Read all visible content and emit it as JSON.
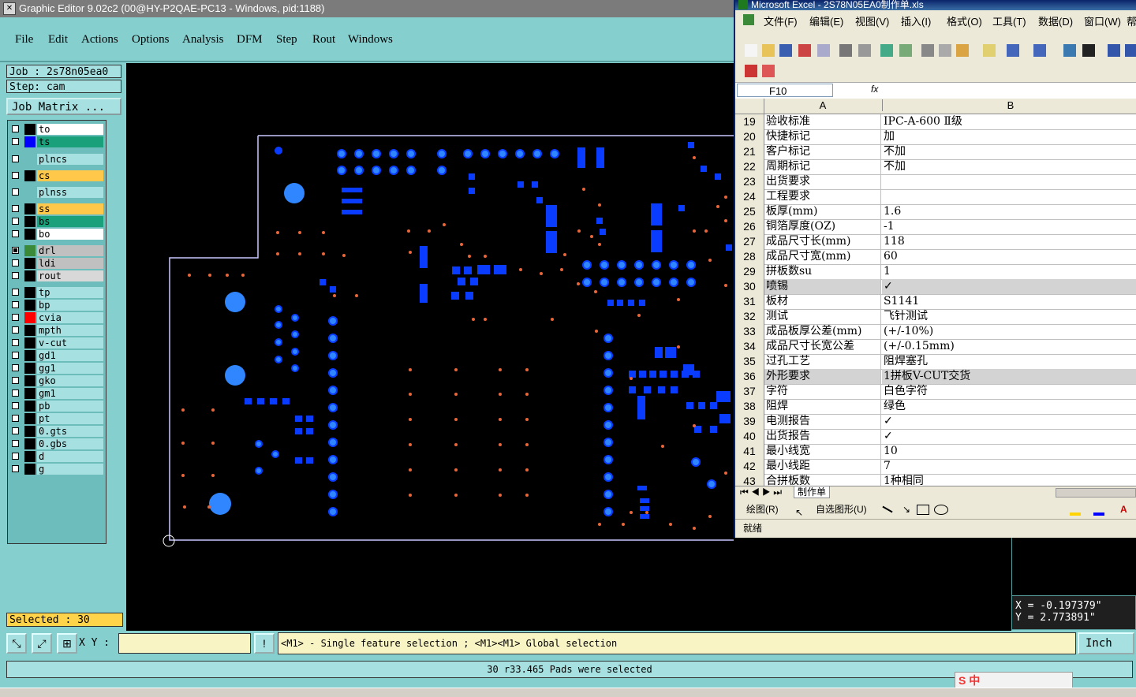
{
  "graphic_editor": {
    "title": "Graphic Editor 9.02c2 (00@HY-P2QAE-PC13 - Windows, pid:1188)",
    "menu": [
      "File",
      "Edit",
      "Actions",
      "Options",
      "Analysis",
      "DFM",
      "Step",
      "Rout",
      "Windows"
    ],
    "job_label": "Job : 2s78n05ea0",
    "step_label": "Step: cam",
    "job_matrix_label": "Job Matrix ...",
    "layers": [
      {
        "name": "to",
        "fill": "#ffffff",
        "swatch": "#000000",
        "checked": false
      },
      {
        "name": "ts",
        "fill": "#1aa07a",
        "swatch": "#0000ff",
        "checked": false
      },
      {
        "name": "plncs",
        "fill": "#a6e0e0",
        "swatch": "#6ebdbd",
        "checked": false
      },
      {
        "name": "cs",
        "fill": "#ffc84a",
        "swatch": "#000000",
        "checked": false
      },
      {
        "name": "plnss",
        "fill": "#a6e0e0",
        "swatch": "#6ebdbd",
        "checked": false
      },
      {
        "name": "ss",
        "fill": "#ffc84a",
        "swatch": "#000000",
        "checked": false
      },
      {
        "name": "bs",
        "fill": "#1aa07a",
        "swatch": "#000000",
        "checked": false
      },
      {
        "name": "bo",
        "fill": "#ffffff",
        "swatch": "#000000",
        "checked": false
      },
      {
        "name": "drl",
        "fill": "#c0c0c0",
        "swatch": "#3a8a3a",
        "checked": true
      },
      {
        "name": "ldi",
        "fill": "#c0c0c0",
        "swatch": "#000000",
        "checked": false
      },
      {
        "name": "rout",
        "fill": "#d8d8d8",
        "swatch": "#000000",
        "checked": false
      },
      {
        "name": "tp",
        "fill": "#a6e0e0",
        "swatch": "#000000",
        "checked": false
      },
      {
        "name": "bp",
        "fill": "#a6e0e0",
        "swatch": "#000000",
        "checked": false
      },
      {
        "name": "cvia",
        "fill": "#a6e0e0",
        "swatch": "#ff0000",
        "checked": false
      },
      {
        "name": "mpth",
        "fill": "#a6e0e0",
        "swatch": "#000000",
        "checked": false
      },
      {
        "name": "v-cut",
        "fill": "#a6e0e0",
        "swatch": "#000000",
        "checked": false
      },
      {
        "name": "gd1",
        "fill": "#a6e0e0",
        "swatch": "#000000",
        "checked": false
      },
      {
        "name": "gg1",
        "fill": "#a6e0e0",
        "swatch": "#000000",
        "checked": false
      },
      {
        "name": "gko",
        "fill": "#a6e0e0",
        "swatch": "#000000",
        "checked": false
      },
      {
        "name": "gm1",
        "fill": "#a6e0e0",
        "swatch": "#000000",
        "checked": false
      },
      {
        "name": "pb",
        "fill": "#a6e0e0",
        "swatch": "#000000",
        "checked": false
      },
      {
        "name": "pt",
        "fill": "#a6e0e0",
        "swatch": "#000000",
        "checked": false
      },
      {
        "name": "0.gts",
        "fill": "#a6e0e0",
        "swatch": "#000000",
        "checked": false
      },
      {
        "name": "0.gbs",
        "fill": "#a6e0e0",
        "swatch": "#000000",
        "checked": false
      },
      {
        "name": "d",
        "fill": "#a6e0e0",
        "swatch": "#000000",
        "checked": false
      },
      {
        "name": "g",
        "fill": "#a6e0e0",
        "swatch": "#000000",
        "checked": false
      }
    ],
    "selected_label": "Selected : 30",
    "xy_label": "X Y :",
    "xy_value": "",
    "hint_text": "<M1> - Single feature selection ; <M1><M1> Global selection",
    "unit_label": "Inch",
    "coord_x": "X = -0.197379\"",
    "coord_y": "Y = 2.773891\"",
    "status_text": "30 r33.465 Pads were selected",
    "colors": {
      "pad": "#0a3cff",
      "pad_highlight": "#2f86ff",
      "smd_dot": "#e8663a",
      "outline": "#c8c8ff"
    }
  },
  "excel": {
    "title": "Microsoft Excel - 2S78N05EA0制作单.xls",
    "menu": [
      "文件(F)",
      "编辑(E)",
      "视图(V)",
      "插入(I)",
      "格式(O)",
      "工具(T)",
      "数据(D)",
      "窗口(W)",
      "帮"
    ],
    "name_box": "F10",
    "fx_label": "fx",
    "col_headers": [
      "A",
      "B"
    ],
    "rows": [
      {
        "n": "19",
        "a": "验收标准",
        "b": "IPC-A-600 Ⅱ级"
      },
      {
        "n": "20",
        "a": "快捷标记",
        "b": "加"
      },
      {
        "n": "21",
        "a": "客户标记",
        "b": "不加"
      },
      {
        "n": "22",
        "a": "周期标记",
        "b": "不加"
      },
      {
        "n": "23",
        "a": "出货要求",
        "b": ""
      },
      {
        "n": "24",
        "a": "工程要求",
        "b": ""
      },
      {
        "n": "25",
        "a": "板厚(mm)",
        "b": "1.6"
      },
      {
        "n": "26",
        "a": "铜箔厚度(OZ)",
        "b": "-1"
      },
      {
        "n": "27",
        "a": "成品尺寸长(mm)",
        "b": "118"
      },
      {
        "n": "28",
        "a": "成品尺寸宽(mm)",
        "b": "60"
      },
      {
        "n": "29",
        "a": "拼板数su",
        "b": "1"
      },
      {
        "n": "30",
        "a": "喷锡",
        "b": "✓",
        "gray": true
      },
      {
        "n": "31",
        "a": "板材",
        "b": "S1141"
      },
      {
        "n": "32",
        "a": "测试",
        "b": "飞针测试"
      },
      {
        "n": "33",
        "a": "成品板厚公差(mm)",
        "b": "(+/-10%)"
      },
      {
        "n": "34",
        "a": "成品尺寸长宽公差",
        "b": "(+/-0.15mm)"
      },
      {
        "n": "35",
        "a": "过孔工艺",
        "b": "阻焊塞孔"
      },
      {
        "n": "36",
        "a": "外形要求",
        "b": "1拼板V-CUT交货",
        "gray": true
      },
      {
        "n": "37",
        "a": "字符",
        "b": "白色字符"
      },
      {
        "n": "38",
        "a": "阻焊",
        "b": "绿色"
      },
      {
        "n": "39",
        "a": "电测报告",
        "b": "✓"
      },
      {
        "n": "40",
        "a": "出货报告",
        "b": "✓"
      },
      {
        "n": "41",
        "a": "最小线宽",
        "b": "10"
      },
      {
        "n": "42",
        "a": "最小线距",
        "b": "7"
      },
      {
        "n": "43",
        "a": "合拼板数",
        "b": "1种相同"
      }
    ],
    "sheet_tab": "制作单",
    "draw_label": "绘图(R)",
    "autoshape_label": "自选图形(U)",
    "ready_label": "就绪"
  },
  "ime_label": "S 中"
}
